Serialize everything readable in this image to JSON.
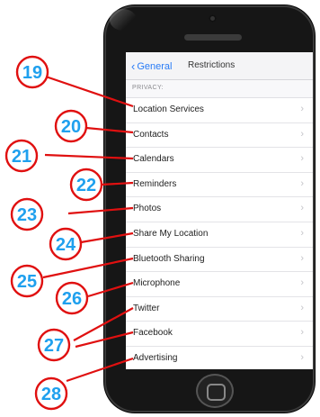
{
  "nav": {
    "back_label": "General",
    "title": "Restrictions"
  },
  "section_header": "PRIVACY:",
  "rows": [
    {
      "label": "Location Services"
    },
    {
      "label": "Contacts"
    },
    {
      "label": "Calendars"
    },
    {
      "label": "Reminders"
    },
    {
      "label": "Photos"
    },
    {
      "label": "Share My Location"
    },
    {
      "label": "Bluetooth Sharing"
    },
    {
      "label": "Microphone"
    },
    {
      "label": "Twitter"
    },
    {
      "label": "Facebook"
    },
    {
      "label": "Advertising"
    }
  ],
  "callouts": [
    "19",
    "20",
    "21",
    "22",
    "23",
    "24",
    "25",
    "26",
    "27",
    "28"
  ],
  "colors": {
    "accent": "#2a7cf6",
    "callout_text": "#1fa0ee",
    "callout_ring": "#e01010"
  },
  "icons": {
    "back": "chevron-left-icon",
    "row": "chevron-right-icon",
    "home": "home-button"
  }
}
